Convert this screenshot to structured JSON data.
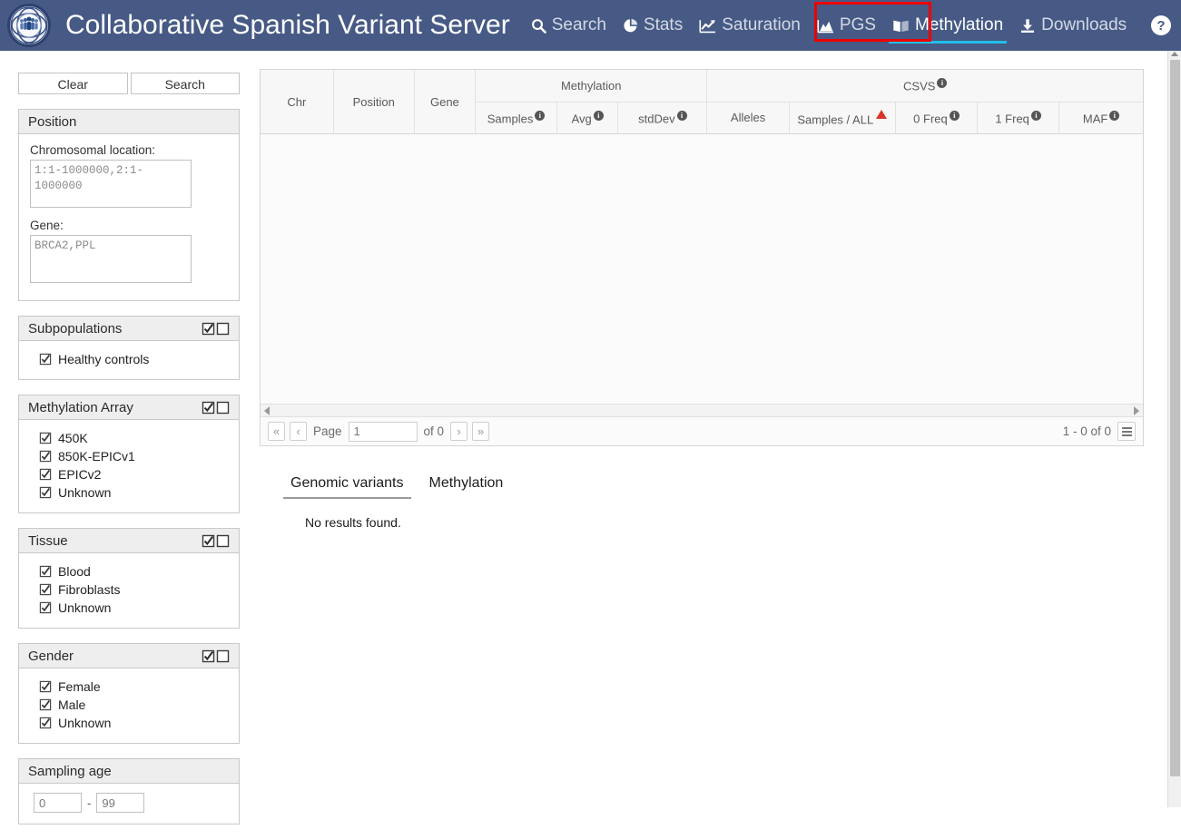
{
  "header": {
    "brand_title": "Collaborative Spanish Variant Server",
    "logo_icon": "csvs-dna-people-logo",
    "help_icon": "question-circle-icon",
    "nav": [
      {
        "label": "Search",
        "icon": "search-icon",
        "active": false
      },
      {
        "label": "Stats",
        "icon": "pie-chart-icon",
        "active": false
      },
      {
        "label": "Saturation",
        "icon": "line-chart-icon",
        "active": false
      },
      {
        "label": "PGS",
        "icon": "area-chart-icon",
        "active": false
      },
      {
        "label": "Methylation",
        "icon": "book-open-icon",
        "active": true
      },
      {
        "label": "Downloads",
        "icon": "download-icon",
        "active": false
      }
    ],
    "highlight_color": "#ee0000",
    "active_underline_color": "#22c0e8",
    "background_color": "#465a85"
  },
  "sidebar": {
    "buttons": [
      {
        "label": "Clear",
        "name": "clear-button"
      },
      {
        "label": "Search",
        "name": "search-button"
      }
    ],
    "panels": [
      {
        "title": "Position",
        "has_toggle": false,
        "fields": [
          {
            "label": "Chromosomal location:",
            "value": "1:1-1000000,2:1-1000000",
            "name": "chromosomal-location-textarea"
          },
          {
            "label": "Gene:",
            "value": "BRCA2,PPL",
            "name": "gene-textarea"
          }
        ]
      },
      {
        "title": "Subpopulations",
        "has_toggle": true,
        "items": [
          {
            "label": "Healthy controls",
            "checked": true
          }
        ]
      },
      {
        "title": "Methylation Array",
        "has_toggle": true,
        "items": [
          {
            "label": "450K",
            "checked": true
          },
          {
            "label": "850K-EPICv1",
            "checked": true
          },
          {
            "label": "EPICv2",
            "checked": true
          },
          {
            "label": "Unknown",
            "checked": true
          }
        ]
      },
      {
        "title": "Tissue",
        "has_toggle": true,
        "items": [
          {
            "label": "Blood",
            "checked": true
          },
          {
            "label": "Fibroblasts",
            "checked": true
          },
          {
            "label": "Unknown",
            "checked": true
          }
        ]
      },
      {
        "title": "Gender",
        "has_toggle": true,
        "items": [
          {
            "label": "Female",
            "checked": true
          },
          {
            "label": "Male",
            "checked": true
          },
          {
            "label": "Unknown",
            "checked": true
          }
        ]
      },
      {
        "title": "Sampling age",
        "has_toggle": false,
        "age_min": "0",
        "age_max": "99",
        "age_separator": "-"
      }
    ]
  },
  "grid": {
    "columns_simple": [
      {
        "label": "Chr",
        "name": "column-chr"
      },
      {
        "label": "Position",
        "name": "column-position"
      },
      {
        "label": "Gene",
        "name": "column-gene"
      }
    ],
    "groups": [
      {
        "label": "Methylation",
        "has_info": false,
        "columns": [
          {
            "label": "Samples",
            "info": true,
            "warn": false
          },
          {
            "label": "Avg",
            "info": true,
            "warn": false
          },
          {
            "label": "stdDev",
            "info": true,
            "warn": false
          }
        ]
      },
      {
        "label": "CSVS",
        "has_info": true,
        "columns": [
          {
            "label": "Alleles",
            "info": false,
            "warn": false
          },
          {
            "label": "Samples / ALL",
            "info": false,
            "warn": true
          },
          {
            "label": "0 Freq",
            "info": true,
            "warn": false
          },
          {
            "label": "1 Freq",
            "info": true,
            "warn": false
          },
          {
            "label": "MAF",
            "info": true,
            "warn": false
          }
        ]
      }
    ],
    "rows": [],
    "empty": true
  },
  "pager": {
    "first_label": "«",
    "prev_label": "‹",
    "page_word": "Page",
    "page_value": "1",
    "of_label": "of 0",
    "next_label": "›",
    "last_label": "»",
    "range_label": "1 - 0 of 0",
    "menu_icon": "hamburger-menu-icon"
  },
  "bottom_tabs": {
    "tabs": [
      {
        "label": "Genomic variants",
        "active": true
      },
      {
        "label": "Methylation",
        "active": false
      }
    ],
    "content": "No results found."
  }
}
